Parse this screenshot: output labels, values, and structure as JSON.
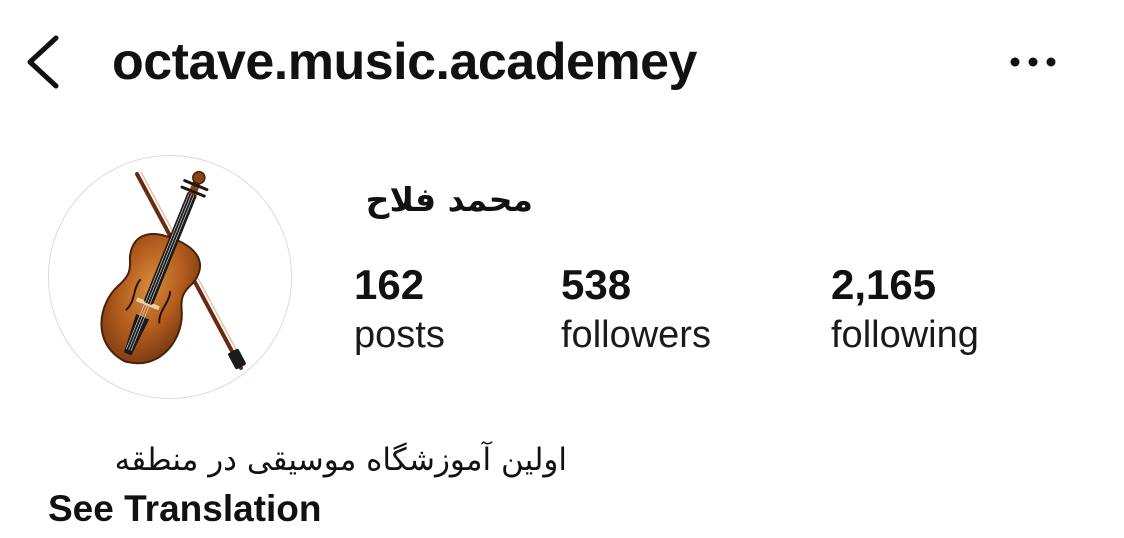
{
  "header": {
    "back_icon": "chevron-left-icon",
    "username": "octave.music.academey",
    "more_icon": "more-horizontal-icon"
  },
  "profile": {
    "avatar_icon": "violin-icon",
    "display_name": "محمد فلاح",
    "stats": {
      "posts": {
        "value": "162",
        "label": "posts"
      },
      "followers": {
        "value": "538",
        "label": "followers"
      },
      "following": {
        "value": "2,165",
        "label": "following"
      }
    },
    "bio": "اولین آموزشگاه موسیقی در منطقه",
    "see_translation": "See Translation"
  }
}
